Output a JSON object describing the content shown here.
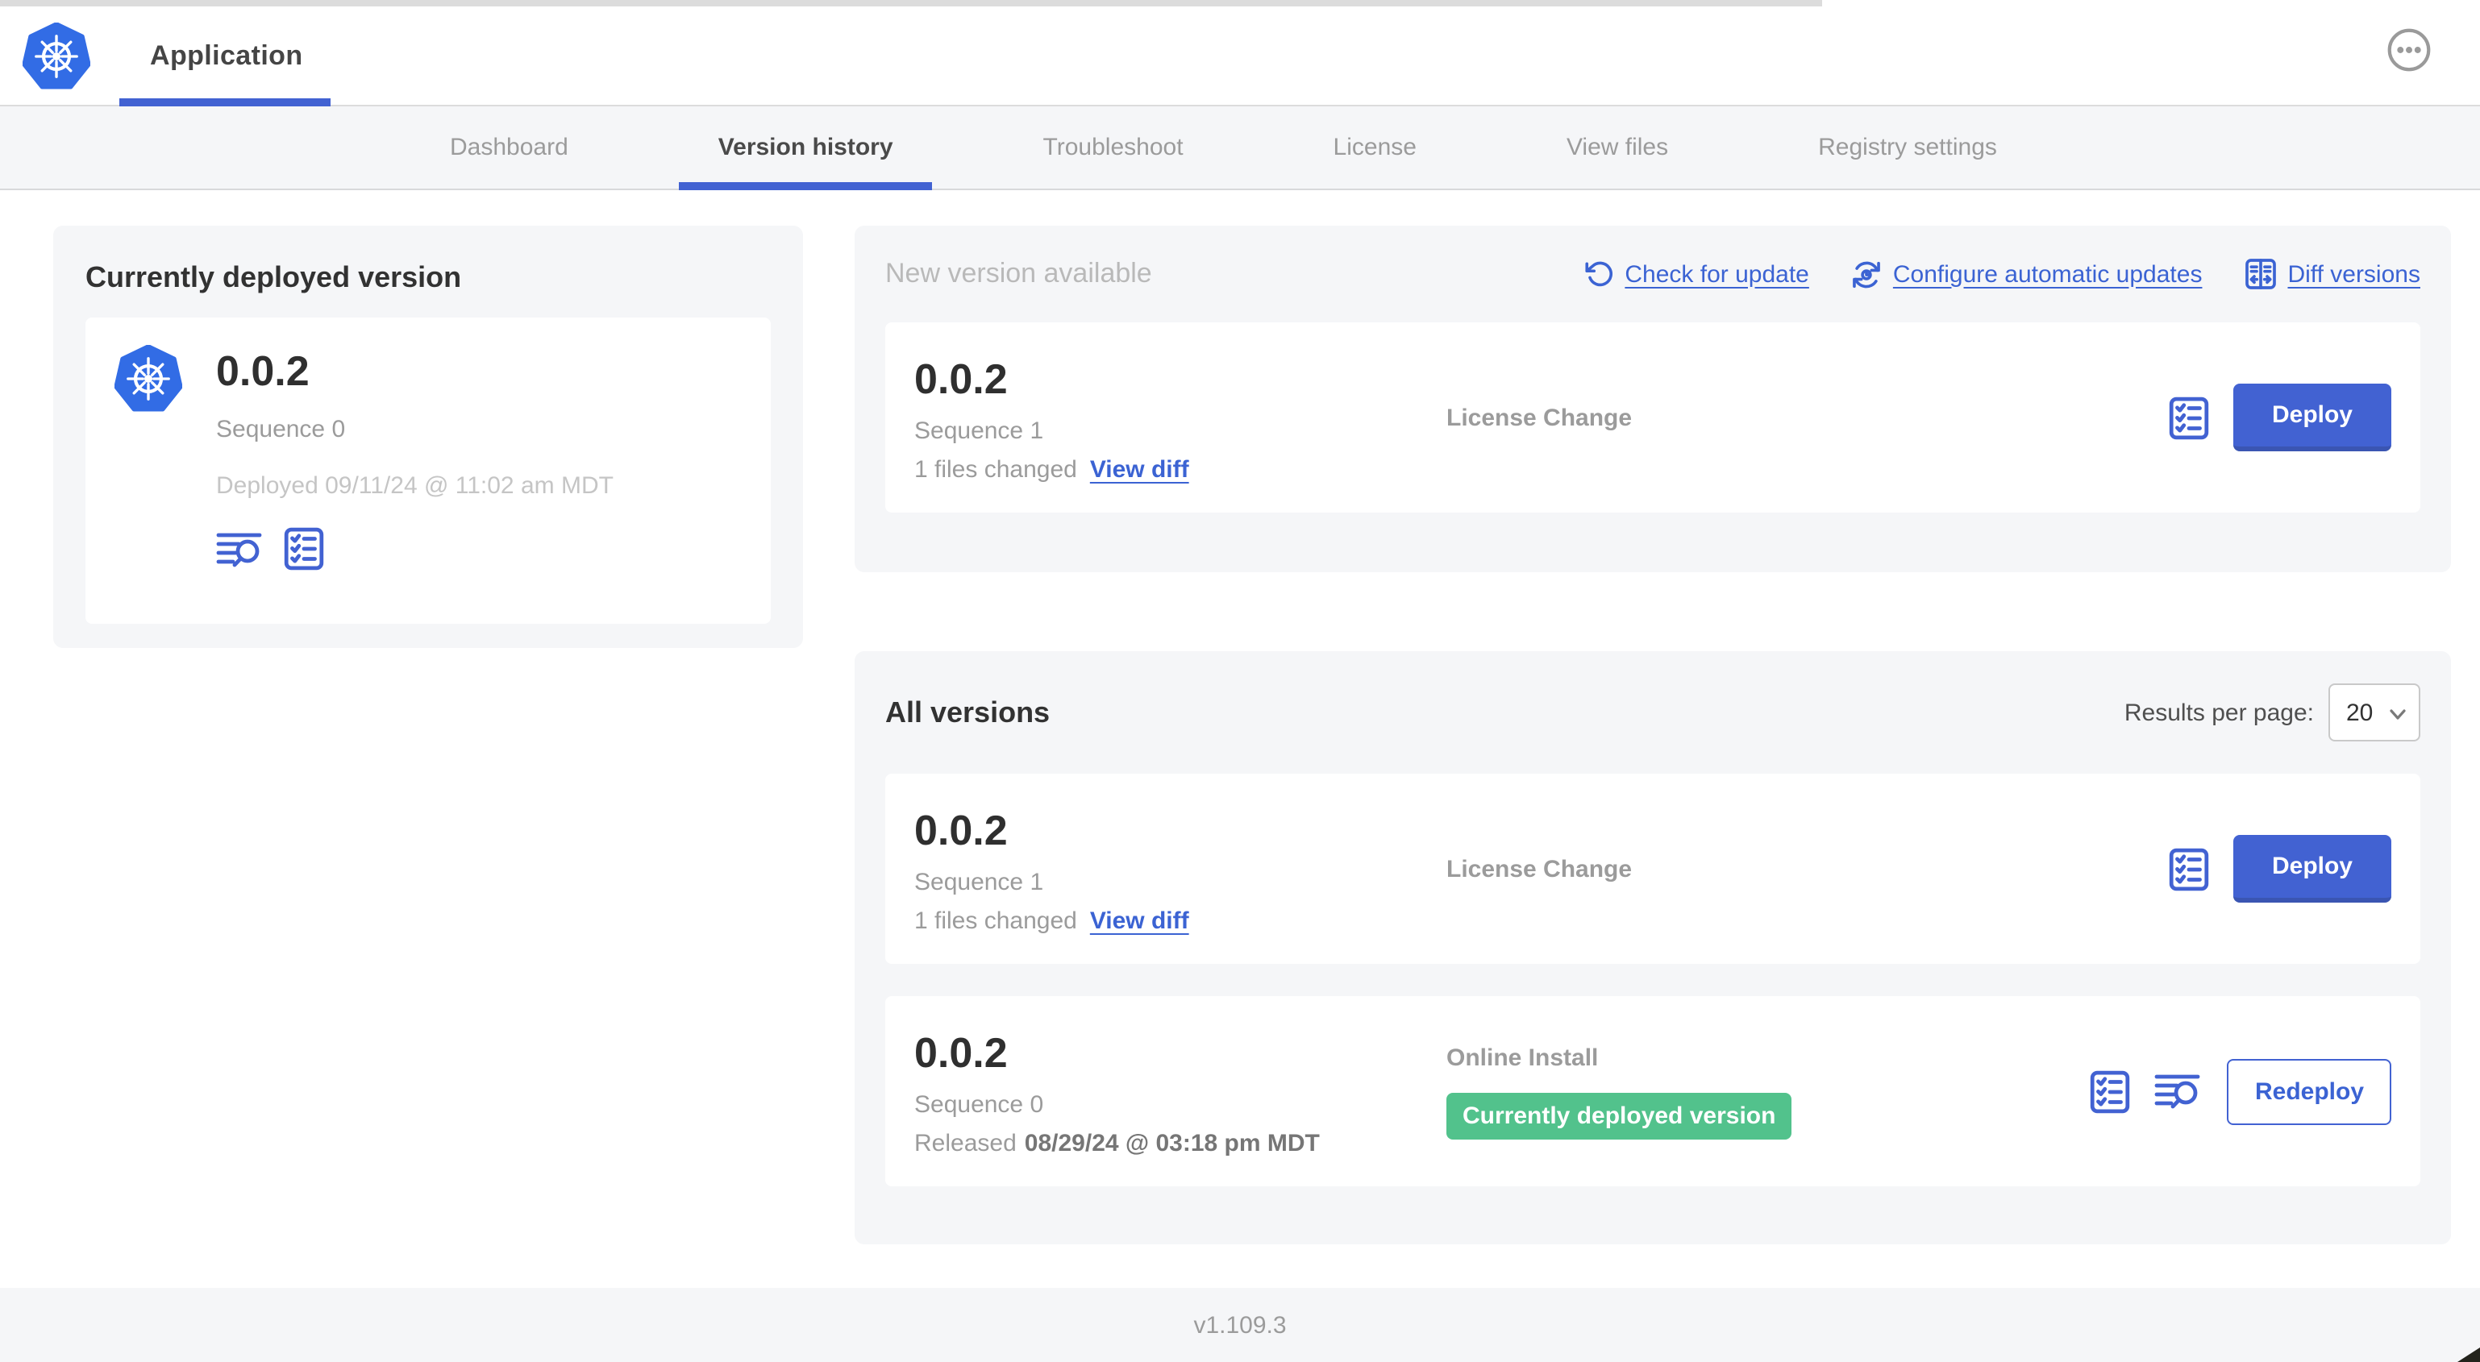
{
  "header": {
    "app_title": "Application"
  },
  "nav": {
    "tabs": [
      {
        "label": "Dashboard"
      },
      {
        "label": "Version history"
      },
      {
        "label": "Troubleshoot"
      },
      {
        "label": "License"
      },
      {
        "label": "View files"
      },
      {
        "label": "Registry settings"
      }
    ],
    "active_tab": "Version history"
  },
  "deployed_card": {
    "title": "Currently deployed version",
    "version": "0.0.2",
    "sequence": "Sequence 0",
    "deployed_timestamp": "Deployed 09/11/24 @ 11:02 am MDT"
  },
  "new_version": {
    "title": "New version available",
    "links": {
      "check_for_update": "Check for update",
      "configure_automatic_updates": "Configure automatic updates",
      "diff_versions": "Diff versions"
    },
    "row": {
      "version": "0.0.2",
      "sequence": "Sequence 1",
      "files_changed": "1 files changed",
      "view_diff": "View diff",
      "source": "License Change",
      "action": "Deploy"
    }
  },
  "all_versions": {
    "title": "All versions",
    "results_per_page_label": "Results per page:",
    "results_per_page_value": "20",
    "rows": [
      {
        "version": "0.0.2",
        "sequence": "Sequence 1",
        "files_changed": "1 files changed",
        "view_diff": "View diff",
        "source": "License Change",
        "action": "Deploy"
      },
      {
        "version": "0.0.2",
        "sequence": "Sequence 0",
        "released_label": "Released",
        "released_timestamp": "08/29/24 @ 03:18 pm MDT",
        "source": "Online Install",
        "badge": "Currently deployed version",
        "action": "Redeploy"
      }
    ]
  },
  "footer": {
    "app_manager_version": "v1.109.3"
  },
  "colors": {
    "primary_blue": "#4262d2",
    "link_blue": "#3b63d3",
    "kubernetes_blue": "#326ce5",
    "badge_green": "#52c28c",
    "panel_gray": "#f5f6f8"
  }
}
